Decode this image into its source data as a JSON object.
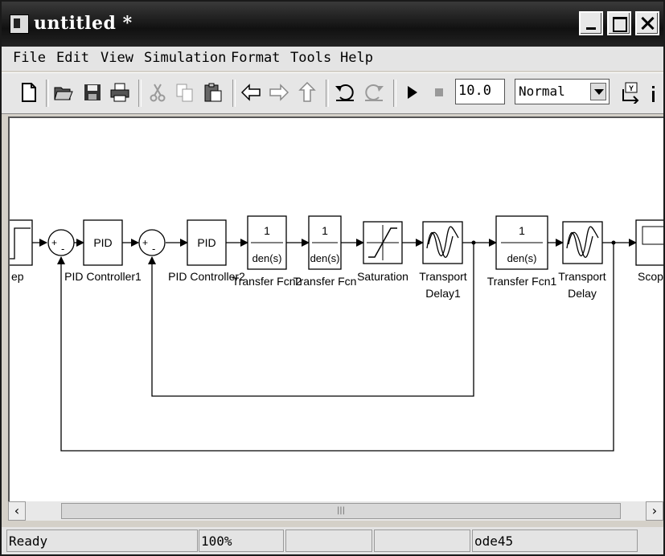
{
  "window": {
    "title": "untitled *"
  },
  "menu": [
    "File",
    "Edit",
    "View",
    "Simulation",
    "Format",
    "Tools",
    "Help"
  ],
  "toolbar": {
    "stop_time": "10.0",
    "sim_mode": "Normal"
  },
  "diagram": {
    "blocks": {
      "step": "ep",
      "pid1": {
        "text": "PID",
        "label": "PID Controller1"
      },
      "pid2": {
        "text": "PID",
        "label": "PID Controller2"
      },
      "tf2": {
        "num": "1",
        "den": "den(s)",
        "label": "Transfer Fcn2"
      },
      "tf": {
        "num": "1",
        "den": "den(s)",
        "label": "Transfer Fcn"
      },
      "sat": {
        "label": "Saturation"
      },
      "td1": {
        "label1": "Transport",
        "label2": "Delay1"
      },
      "tf1": {
        "num": "1",
        "den": "den(s)",
        "label": "Transfer Fcn1"
      },
      "td": {
        "label1": "Transport",
        "label2": "Delay"
      },
      "scope": {
        "label": "Scop"
      }
    },
    "sum_signs": {
      "plus": "+",
      "minus": "-"
    }
  },
  "status": {
    "text": "Ready",
    "zoom": "100%",
    "solver": "ode45"
  }
}
